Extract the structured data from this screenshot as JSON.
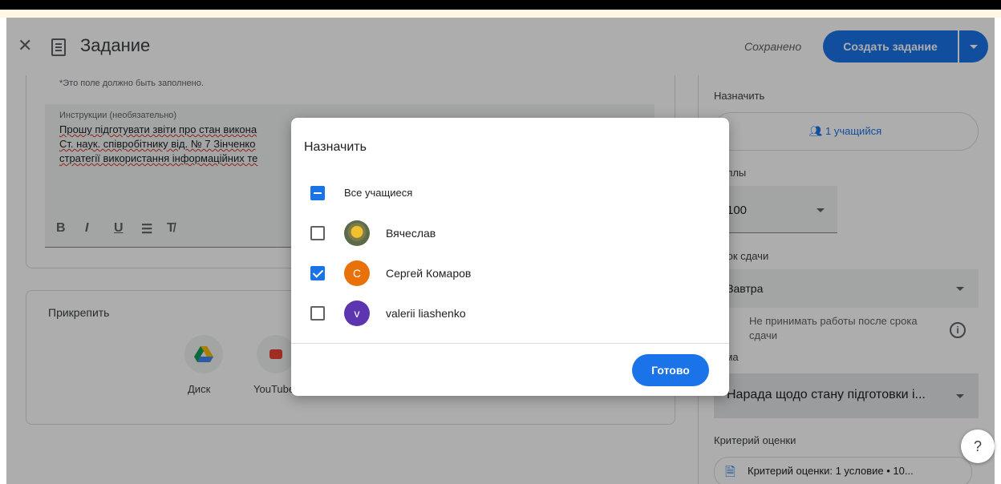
{
  "header": {
    "title": "Задание",
    "saved_status": "Сохранено",
    "create_button": "Создать задание"
  },
  "form": {
    "required_note": "*Это поле должно быть заполнено.",
    "instructions_label": "Инструкции (необязательно)",
    "instructions_lines": [
      "Прошу підготувати звіти про стан викона",
      "Ст. наук. співробітнику від. № 7 Зінченко",
      "стратегії  використання інформаційних те"
    ],
    "toolbar": {
      "bold": "B",
      "italic": "I",
      "underline": "U",
      "list": "☰",
      "clear": "T̸"
    }
  },
  "attach": {
    "label": "Прикрепить",
    "items": [
      {
        "label": "Диск",
        "icon": "google-drive-icon"
      },
      {
        "label": "YouTube",
        "icon": "youtube-icon"
      }
    ]
  },
  "sidebar": {
    "assign_label": "Назначить",
    "assign_button": "1 учащийся",
    "points_label": "Баллы",
    "points_value": "100",
    "due_label": "Срок сдачи",
    "due_value": "Завтра",
    "late_toggle_label": "Не принимать работы после срока сдачи",
    "topic_label": "Тема",
    "topic_value": "Нарада щодо стану підготовки і...",
    "rubric_label": "Критерий оценки",
    "rubric_chip": "Критерий оценки: 1 условие • 10..."
  },
  "modal": {
    "title": "Назначить",
    "items": [
      {
        "label": "Все учащиеся",
        "state": "indeterminate",
        "avatar": ""
      },
      {
        "label": "Вячеслав",
        "state": "unchecked",
        "avatar": "photo"
      },
      {
        "label": "Сергей Комаров",
        "state": "checked",
        "avatar": "С",
        "avatar_color": "#e8710a"
      },
      {
        "label": "valerii liashenko",
        "state": "unchecked",
        "avatar": "v",
        "avatar_color": "#5e35b1"
      }
    ],
    "done_button": "Готово"
  },
  "colors": {
    "accent": "#1a73e8"
  }
}
